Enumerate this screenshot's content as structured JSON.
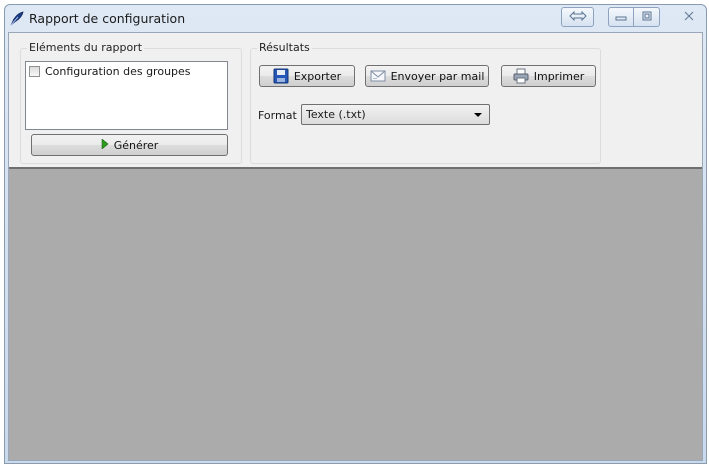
{
  "window": {
    "title": "Rapport de configuration",
    "icon": "feather-pen-icon",
    "controls": [
      "restore-double-arrow-icon",
      "minimize-icon",
      "maximize-icon",
      "close-icon"
    ]
  },
  "report_elements": {
    "legend": "Eléments du rapport",
    "items": [
      {
        "label": "Configuration des groupes",
        "checked": false
      }
    ],
    "generate_label": "Générer"
  },
  "results": {
    "legend": "Résultats",
    "export_label": "Exporter",
    "mail_label": "Envoyer par mail",
    "print_label": "Imprimer",
    "format_label": "Format :",
    "format_value": "Texte (.txt)"
  },
  "colors": {
    "preview_background": "#ababab",
    "client_background": "#f0f0f0",
    "generate_arrow": "#2e9a1f"
  }
}
